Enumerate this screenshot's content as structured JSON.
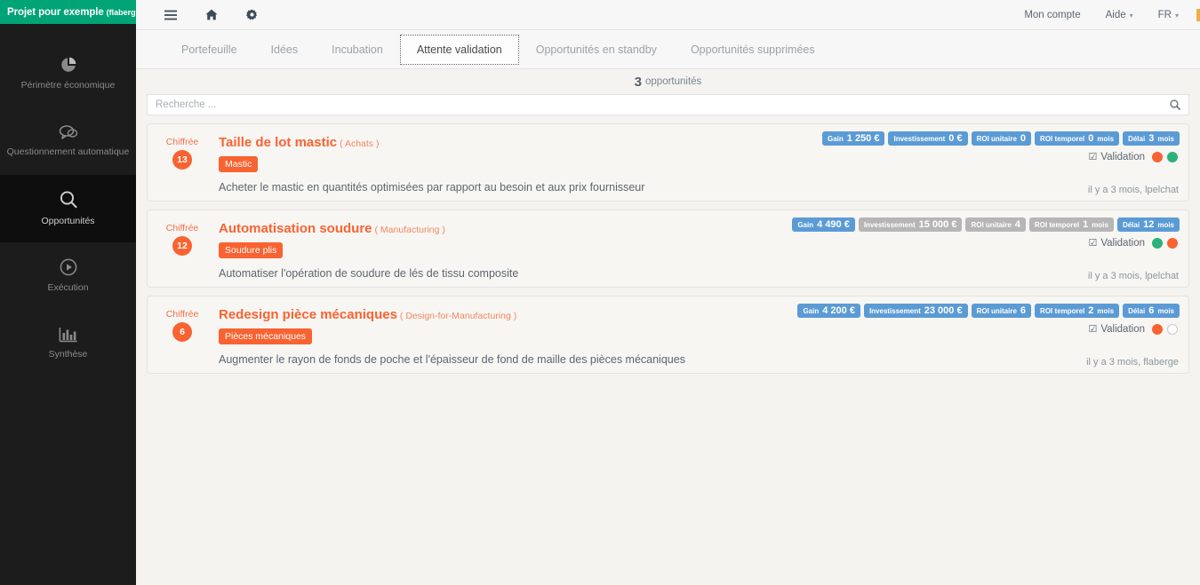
{
  "sidebar": {
    "project": {
      "name": "Projet pour exemple",
      "owner": "(flaberge)",
      "caret": "▾"
    },
    "items": [
      {
        "label": "Périmètre économique",
        "icon": "pie-chart-icon",
        "active": false
      },
      {
        "label": "Questionnement automatique",
        "icon": "chat-bubbles-icon",
        "active": false
      },
      {
        "label": "Opportunités",
        "icon": "magnifier-icon",
        "active": true
      },
      {
        "label": "Exécution",
        "icon": "play-circle-icon",
        "active": false
      },
      {
        "label": "Synthèse",
        "icon": "bar-chart-icon",
        "active": false
      }
    ]
  },
  "topbar": {
    "icons": [
      {
        "name": "hamburger-menu-icon"
      },
      {
        "name": "home-icon"
      },
      {
        "name": "gear-icon"
      }
    ],
    "account_label": "Mon compte",
    "help_label": "Aide",
    "language_label": "FR",
    "caret": "▾"
  },
  "tabs": [
    {
      "label": "Portefeuille",
      "active": false
    },
    {
      "label": "Idées",
      "active": false
    },
    {
      "label": "Incubation",
      "active": false
    },
    {
      "label": "Attente validation",
      "active": true
    },
    {
      "label": "Opportunités en standby",
      "active": false
    },
    {
      "label": "Opportunités supprimées",
      "active": false
    }
  ],
  "count": {
    "number": "3",
    "label": "opportunités"
  },
  "search": {
    "placeholder": "Recherche ...",
    "value": "",
    "icon": "search-icon"
  },
  "validation": {
    "label": "Validation",
    "check_glyph": "☑"
  },
  "colors": {
    "brand_green": "#00a477",
    "accent_orange": "#f96332",
    "badge_blue": "#5b9bd5",
    "badge_muted": "#b6b6b6",
    "dot_green": "#2ab27b",
    "sidebar_bg": "#1c1c1c"
  },
  "cards": [
    {
      "status_text": "Chiffrée",
      "status_number": "13",
      "title": "Taille de lot mastic",
      "category": "( Achats )",
      "tag": "Mastic",
      "description": "Acheter le mastic en quantités optimisées par rapport au besoin et aux prix fournisseur",
      "badges": [
        {
          "label": "Gain",
          "value": "1 250 €",
          "unit": "",
          "muted": false
        },
        {
          "label": "Investissement",
          "value": "0 €",
          "unit": "",
          "muted": false
        },
        {
          "label": "ROI unitaire",
          "value": "0",
          "unit": "",
          "muted": false
        },
        {
          "label": "ROI temporel",
          "value": "0",
          "unit": "mois",
          "muted": false
        },
        {
          "label": "Délai",
          "value": "3",
          "unit": "mois",
          "muted": false
        }
      ],
      "dots": [
        "orange",
        "green"
      ],
      "footer": "il y a 3 mois, lpelchat"
    },
    {
      "status_text": "Chiffrée",
      "status_number": "12",
      "title": "Automatisation soudure",
      "category": "( Manufacturing )",
      "tag": "Soudure plis",
      "description": "Automatiser l'opération de soudure de lés de tissu composite",
      "badges": [
        {
          "label": "Gain",
          "value": "4 490 €",
          "unit": "",
          "muted": false
        },
        {
          "label": "Investissement",
          "value": "15 000 €",
          "unit": "",
          "muted": true
        },
        {
          "label": "ROI unitaire",
          "value": "4",
          "unit": "",
          "muted": true
        },
        {
          "label": "ROI temporel",
          "value": "1",
          "unit": "mois",
          "muted": true
        },
        {
          "label": "Délai",
          "value": "12",
          "unit": "mois",
          "muted": false
        }
      ],
      "dots": [
        "green",
        "orange"
      ],
      "footer": "il y a 3 mois, lpelchat"
    },
    {
      "status_text": "Chiffrée",
      "status_number": "6",
      "title": "Redesign pièce mécaniques",
      "category": "( Design-for-Manufacturing )",
      "tag": "Pièces mécaniques",
      "description": "Augmenter le rayon de fonds de poche et l'épaisseur de fond de maille des pièces mécaniques",
      "badges": [
        {
          "label": "Gain",
          "value": "4 200 €",
          "unit": "",
          "muted": false
        },
        {
          "label": "Investissement",
          "value": "23 000 €",
          "unit": "",
          "muted": false
        },
        {
          "label": "ROI unitaire",
          "value": "6",
          "unit": "",
          "muted": false
        },
        {
          "label": "ROI temporel",
          "value": "2",
          "unit": "mois",
          "muted": false
        },
        {
          "label": "Délai",
          "value": "6",
          "unit": "mois",
          "muted": false
        }
      ],
      "dots": [
        "orange",
        "empty"
      ],
      "footer": "il y a 3 mois, flaberge"
    }
  ]
}
